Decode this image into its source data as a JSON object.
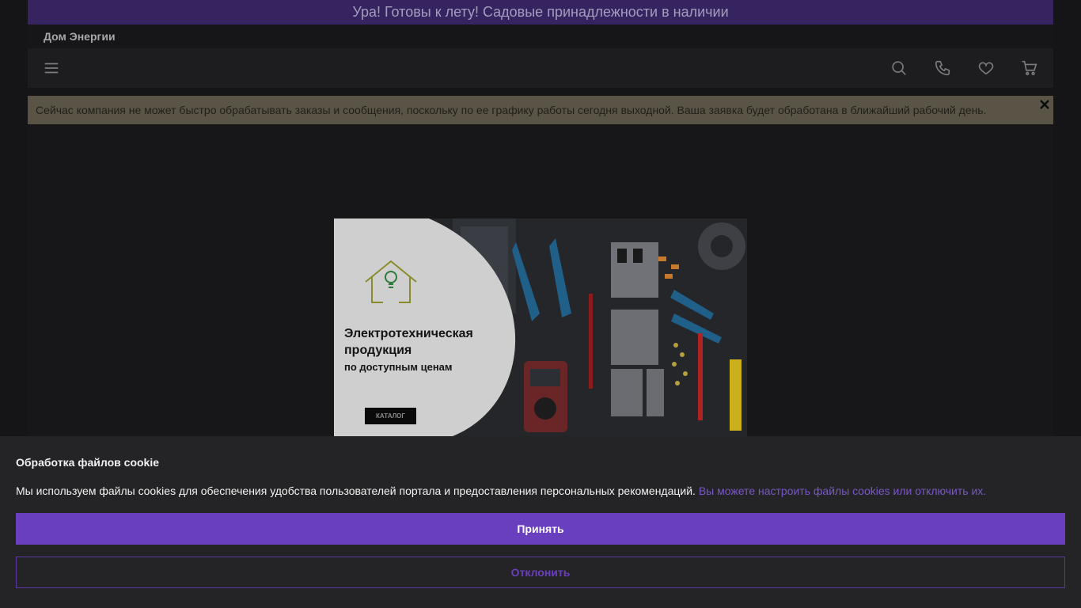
{
  "promo": {
    "text": "Ура! Готовы к лету! Садовые принадлежности в наличии"
  },
  "header": {
    "brand": "Дом Энергии",
    "icons": [
      "menu-icon",
      "search-icon",
      "phone-icon",
      "heart-icon",
      "cart-icon"
    ]
  },
  "notice": {
    "text": "Сейчас компания не может быстро обрабатывать заказы и сообщения, поскольку по ее графику работы сегодня выходной. Ваша заявка будет обработана в ближайший рабочий день.",
    "close_icon": "close-icon"
  },
  "banner": {
    "line1": "Электротехническая",
    "line2": "продукция",
    "line3": "по доступным ценам",
    "button": "КАТАЛОГ"
  },
  "cookie": {
    "title": "Обработка файлов cookie",
    "text": "Мы используем файлы cookies для обеспечения удобства пользователей портала и предоставления персональных рекомендаций.",
    "link": "Вы можете настроить файлы cookies или отключить их.",
    "accept": "Принять",
    "decline": "Отклонить"
  },
  "colors": {
    "accent": "#6a3fbf",
    "promo_bg": "#35245f",
    "notice_bg": "#5a5446",
    "page_bg": "#151417"
  }
}
